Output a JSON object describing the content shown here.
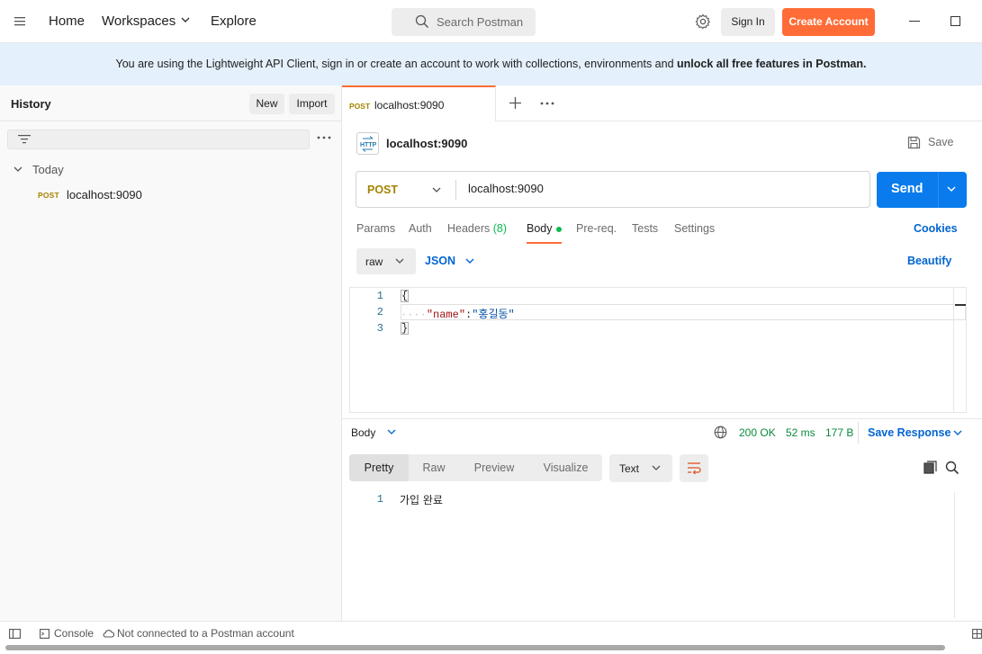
{
  "topbar": {
    "nav": [
      "Home",
      "Workspaces",
      "Explore"
    ],
    "search_placeholder": "Search Postman",
    "sign_in": "Sign In",
    "create_account": "Create Account",
    "accent": "#ff6c37"
  },
  "banner": {
    "text": "You are using the Lightweight API Client, sign in or create an account to work with collections, environments and ",
    "bold": "unlock all free features in Postman."
  },
  "sidebar": {
    "title": "History",
    "new_label": "New",
    "import_label": "Import",
    "group": "Today",
    "items": [
      {
        "method": "POST",
        "url": "localhost:9090"
      }
    ]
  },
  "tabs": [
    {
      "method": "POST",
      "name": "localhost:9090"
    }
  ],
  "request": {
    "title": "localhost:9090",
    "save_label": "Save",
    "method": "POST",
    "url": "localhost:9090",
    "send_label": "Send",
    "tabs": [
      "Params",
      "Auth",
      "Headers",
      "Body",
      "Pre-req.",
      "Tests",
      "Settings"
    ],
    "headers_count": "(8)",
    "active_tab": "Body",
    "cookies_label": "Cookies",
    "body_mode": "raw",
    "body_lang": "JSON",
    "beautify_label": "Beautify",
    "body_lines": [
      {
        "n": "1",
        "text": "{"
      },
      {
        "n": "2",
        "key": "\"name\"",
        "sep": ":",
        "value": "\"홍길동\""
      },
      {
        "n": "3",
        "text": "}"
      }
    ]
  },
  "response": {
    "label": "Body",
    "status": "200 OK",
    "time": "52 ms",
    "size": "177 B",
    "save_response": "Save Response",
    "view_tabs": [
      "Pretty",
      "Raw",
      "Preview",
      "Visualize"
    ],
    "active_view": "Pretty",
    "format": "Text",
    "lines": [
      {
        "n": "1",
        "text": "가입 완료"
      }
    ]
  },
  "bottombar": {
    "console": "Console",
    "status": "Not connected to a Postman account"
  },
  "colors": {
    "send_blue": "#097bed",
    "link_blue": "#0265d2",
    "post_method": "#a58300",
    "status_green": "#0b8a3d",
    "banner_bg": "#e4f0fb"
  }
}
